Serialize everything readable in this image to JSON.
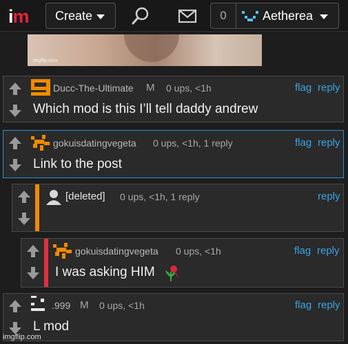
{
  "header": {
    "logo_i": "i",
    "logo_m": "m",
    "create_label": "Create",
    "notification_count": "0",
    "username": "Aetherea"
  },
  "meme": {
    "credit": "imgflip.com"
  },
  "comments": [
    {
      "username": "Ducc-The-Ultimate",
      "badge": "M",
      "meta": "0 ups, <1h",
      "flag": "flag",
      "reply": "reply",
      "body": "Which mod is this I’ll tell daddy andrew"
    },
    {
      "username": "gokuisdatingvegeta",
      "meta": "0 ups, <1h, 1 reply",
      "flag": "flag",
      "reply": "reply",
      "body": "Link to the post"
    },
    {
      "username": "[deleted]",
      "meta": "0 ups, <1h, 1 reply",
      "reply": "reply",
      "body": ""
    },
    {
      "username": "gokuisdatingvegeta",
      "meta": "0 ups, <1h",
      "flag": "flag",
      "reply": "reply",
      "body": "I was asking HIM"
    },
    {
      "username": ".999",
      "badge": "M",
      "meta": "0 ups, <1h",
      "flag": "flag",
      "reply": "reply",
      "body": "L mod"
    }
  ],
  "footer": {
    "credit": "imgflip.com"
  },
  "colors": {
    "accent_orange": "#f18a00",
    "accent_red": "#e0313d",
    "link_blue": "#3aa4e6",
    "highlight_border": "#2e8fd0"
  }
}
